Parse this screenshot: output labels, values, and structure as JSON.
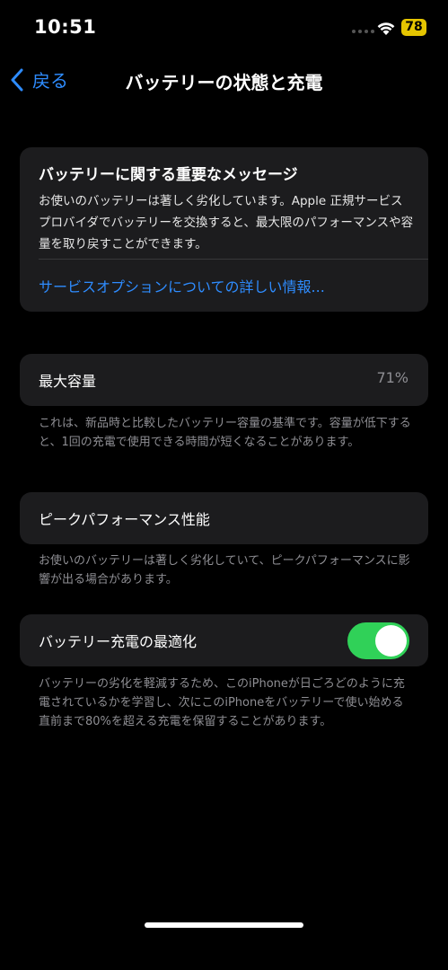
{
  "status_bar": {
    "time": "10:51",
    "battery_level": "78",
    "battery_color": "#e5c500"
  },
  "nav": {
    "back_label": "戻る",
    "title": "バッテリーの状態と充電"
  },
  "message_card": {
    "title": "バッテリーに関する重要なメッセージ",
    "body": "お使いのバッテリーは著しく劣化しています。Apple 正規サービスプロバイダでバッテリーを交換すると、最大限のパフォーマンスや容量を取り戻すことができます。",
    "link": "サービスオプションについての詳しい情報..."
  },
  "max_capacity": {
    "label": "最大容量",
    "value": "71%",
    "footnote": "これは、新品時と比較したバッテリー容量の基準です。容量が低下すると、1回の充電で使用できる時間が短くなることがあります。"
  },
  "peak_performance": {
    "label": "ピークパフォーマンス性能",
    "footnote": "お使いのバッテリーは著しく劣化していて、ピークパフォーマンスに影響が出る場合があります。"
  },
  "optimized_charging": {
    "label": "バッテリー充電の最適化",
    "enabled": true,
    "footnote": "バッテリーの劣化を軽減するため、このiPhoneが日ごろどのように充電されているかを学習し、次にこのiPhoneをバッテリーで使い始める直前まで80%を超える充電を保留することがあります。"
  },
  "colors": {
    "accent": "#2e8cff",
    "toggle_on": "#30d158",
    "card": "#1c1c1e"
  }
}
